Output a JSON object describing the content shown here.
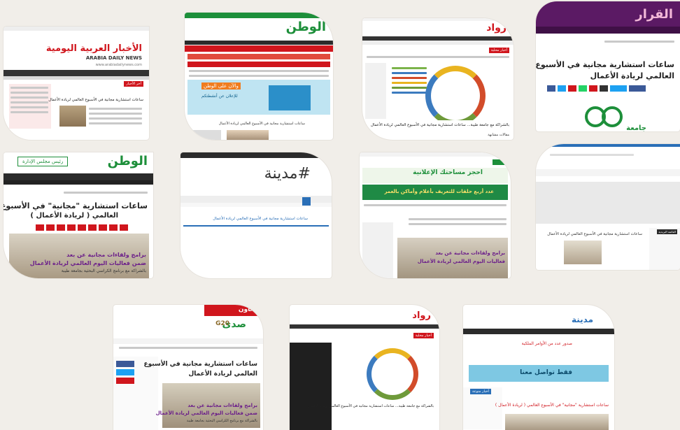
{
  "cards": {
    "c1": {
      "logo": "الأخبار العربية اليومية",
      "logo_en": "ARABIA DAILY NEWS",
      "url": "www.arabiadailynews.com",
      "headline": "ساعات استشارية مجانية في الأسبوع العالمي لريادة الأعمال",
      "nav_tag": "أخر الأخبار"
    },
    "c2": {
      "logo": "الوطن",
      "banner_title": "والآن على الوطن",
      "banner_sub": "للإعلان عن أنشطتكم",
      "headline": "ساعات استشارية مجانية في الأسبوع العالمي لريادة الأعمال"
    },
    "c3": {
      "logo": "رواد",
      "tag": "أخبار محلية",
      "headline": "بالشراكة مع جامعة طيبة... ساعات استشارية مجانية في الأسبوع العالمي لريادة الأعمال",
      "footer": "مقالات مشابهة"
    },
    "c4": {
      "logo": "القرار",
      "headline_line1": "ساعات استشارية مجانية في الأسبوع",
      "headline_line2": "العالمي لريادة الأعمال",
      "partial": "جامعة"
    },
    "c5": {
      "logo": "الوطن",
      "sub": "رئيس مجلس الإدارة",
      "headline_line1": "ساعات استشارية \"مجانية\" في الأسبوع",
      "headline_line2": "العالمي ( لريادة الأعمال )",
      "caption1": "برامج ولقاءات مجانية عن بعد",
      "caption2": "ضمن فعاليات اليوم العالمي لريادة الأعمال",
      "caption3": "بالشراكة مع برنامج الكراسي البحثية بجامعة طيبة"
    },
    "c6": {
      "logo": "#مدينة",
      "headline": "ساعات استشارية مجانية في الأسبوع العالمي لريادة الأعمال"
    },
    "c7": {
      "ad1": "احجز مساحتك الإعلانية",
      "ad2": "عدد أربع حلقات للتعريف بأعلام وأماكن بالعمر",
      "caption1": "برامج ولقاءات مجانية عن بعد",
      "caption2": "فعاليات اليوم العالمي لريادة الأعمال"
    },
    "c8": {
      "headline": "ساعات استشارية مجانية في الأسبوع العالمي لريادة الأعمال",
      "side_title": "القائمة البريدية"
    },
    "c9": {
      "logo": "صدى",
      "badge": "G20",
      "top_ad": "تعاون",
      "headline_line1": "ساعات استشارية مجانية في الأسبوع",
      "headline_line2": "العالمي لريادة الأعمال",
      "caption1": "برامج ولقاءات مجانية عن بعد",
      "caption2": "ضمن فعاليات اليوم العالمي لريادة الأعمال",
      "caption3": "بالشراكة مع برنامج الكراسي البحثية بجامعة طيبة"
    },
    "c10": {
      "logo": "رواد",
      "tag": "أخبار محلية",
      "headline": "بالشراكة مع جامعة طيبة... ساعات استشارية مجانية في الأسبوع العالمي لريادة الأعمال"
    },
    "c11": {
      "logo": "مدينة",
      "banner": "فقط تواصل معنا",
      "ad_top": "صدور عدد من الأوامر الملكية",
      "headline": "ساعات استشارية \"مجانية\" في الأسبوع العالمي ( لريادة الأعمال )",
      "side_title": "أخبار منوعة"
    }
  },
  "colors": {
    "background": "#f1eee9",
    "red": "#d0161d",
    "green": "#1d8f3a",
    "purple": "#5b1a64",
    "dark": "#222222",
    "blue": "#2a6fb7"
  }
}
